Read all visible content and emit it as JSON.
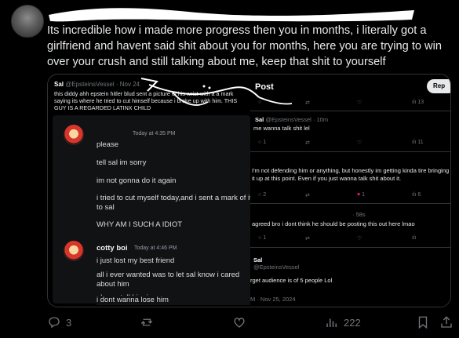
{
  "post": {
    "text": "Its incredible how i made more progress then you in months, i literally got a girlfriend and havent said shit about you for months, here you are trying to win over your crush and still talking about me, keep that shit to yourself"
  },
  "embedded": {
    "left": {
      "author": "Sal",
      "handle": "@EpsteinsVessel",
      "date": "· Nov 24",
      "text": "this diddy ahh epstein hitler blud sent a picture of his wrist with a a mark saying its where he tried to cut himself because i broke up with him. THIS GUY IS A REGARDED LATINX CHILD",
      "chat": {
        "time_1": "Today at 4:35 PM",
        "lines_1": [
          "please",
          "tell sal im sorry",
          "im not gonna do it again",
          "i tried to cut myself today,and i sent a mark of it to sal",
          "WHY AM I SUCH A IDIOT"
        ],
        "name_2": "cotty boi",
        "time_2": "Today at 4:46 PM",
        "lines_2": [
          "i just lost my best friend",
          "all i ever wanted was to let sal know i cared about him",
          "please tell him im sorry",
          "i dont wanna lose him"
        ]
      }
    },
    "right": {
      "title": "Post",
      "reply_label": "Rep",
      "top_views": "13",
      "reply1_author": "Sal",
      "reply1_handle": "@EpsteinsVessel · 10m",
      "reply1_text": "me wanna talk shit lel",
      "reply1_replies": "1",
      "reply1_views": "11",
      "reply2_text": "I'm not defending him or anything, but honestly im getting kinda tire bringing it up at this point. Even if you just wanna talk shit about it.",
      "reply2_replies": "2",
      "reply2_likes": "1",
      "reply2_views": "6",
      "reply3_time": "· 58s",
      "reply3_text": "agreed bro i dont think he should be posting this out here lmao",
      "reply3_replies": "1",
      "reply4_author": "Sal",
      "reply4_handle": "@EpsteinsVessel",
      "reply4_text": "rget audience is of 5 people Lol",
      "reply4_date": "M · Nov 25, 2024"
    }
  },
  "actions": {
    "replies": "3",
    "views": "222"
  },
  "icons": [
    "reply-icon",
    "repost-icon",
    "like-icon",
    "views-icon",
    "bookmark-icon",
    "share-icon"
  ]
}
